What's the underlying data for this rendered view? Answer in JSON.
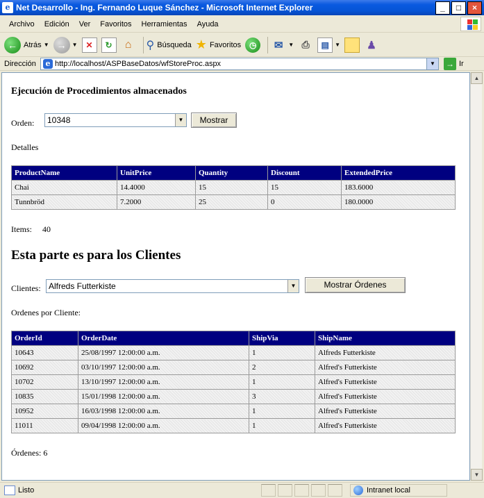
{
  "window": {
    "title": "Net Desarrollo - Ing. Fernando Luque Sánchez - Microsoft Internet Explorer"
  },
  "menu": [
    "Archivo",
    "Edición",
    "Ver",
    "Favoritos",
    "Herramientas",
    "Ayuda"
  ],
  "toolbar": {
    "back_label": "Atrás",
    "search_label": "Búsqueda",
    "favorites_label": "Favoritos"
  },
  "address": {
    "label": "Dirección",
    "url": "http://localhost/ASPBaseDatos/wfStoreProc.aspx",
    "go_label": "Ir"
  },
  "page": {
    "heading_proc": "Ejecución de Procedimientos almacenados",
    "orden_label": "Orden:",
    "orden_value": "10348",
    "mostrar_button": "Mostrar",
    "detalles_label": "Detalles",
    "detalles_table": {
      "columns": [
        "ProductName",
        "UnitPrice",
        "Quantity",
        "Discount",
        "ExtendedPrice"
      ],
      "rows": [
        [
          "Chai",
          "14.4000",
          "15",
          "15",
          "183.6000"
        ],
        [
          "Tunnbröd",
          "7.2000",
          "25",
          "0",
          "180.0000"
        ]
      ]
    },
    "items_label": "Items:",
    "items_value": "40",
    "heading_clientes": "Esta parte es para los Clientes",
    "clientes_label": "Clientes:",
    "clientes_value": "Alfreds Futterkiste",
    "mostrar_ordenes_button": "Mostrar Órdenes",
    "ordenes_cliente_label": "Ordenes por Cliente:",
    "ordenes_table": {
      "columns": [
        "OrderId",
        "OrderDate",
        "ShipVia",
        "ShipName"
      ],
      "rows": [
        [
          "10643",
          "25/08/1997 12:00:00 a.m.",
          "1",
          "Alfreds Futterkiste"
        ],
        [
          "10692",
          "03/10/1997 12:00:00 a.m.",
          "2",
          "Alfred's Futterkiste"
        ],
        [
          "10702",
          "13/10/1997 12:00:00 a.m.",
          "1",
          "Alfred's Futterkiste"
        ],
        [
          "10835",
          "15/01/1998 12:00:00 a.m.",
          "3",
          "Alfred's Futterkiste"
        ],
        [
          "10952",
          "16/03/1998 12:00:00 a.m.",
          "1",
          "Alfred's Futterkiste"
        ],
        [
          "11011",
          "09/04/1998 12:00:00 a.m.",
          "1",
          "Alfred's Futterkiste"
        ]
      ]
    },
    "ordenes_count_label": "Órdenes: 6"
  },
  "status": {
    "text": "Listo",
    "zone": "Intranet local"
  },
  "colors": {
    "grid_header": "#000080",
    "titlebar": "#0654d6"
  }
}
